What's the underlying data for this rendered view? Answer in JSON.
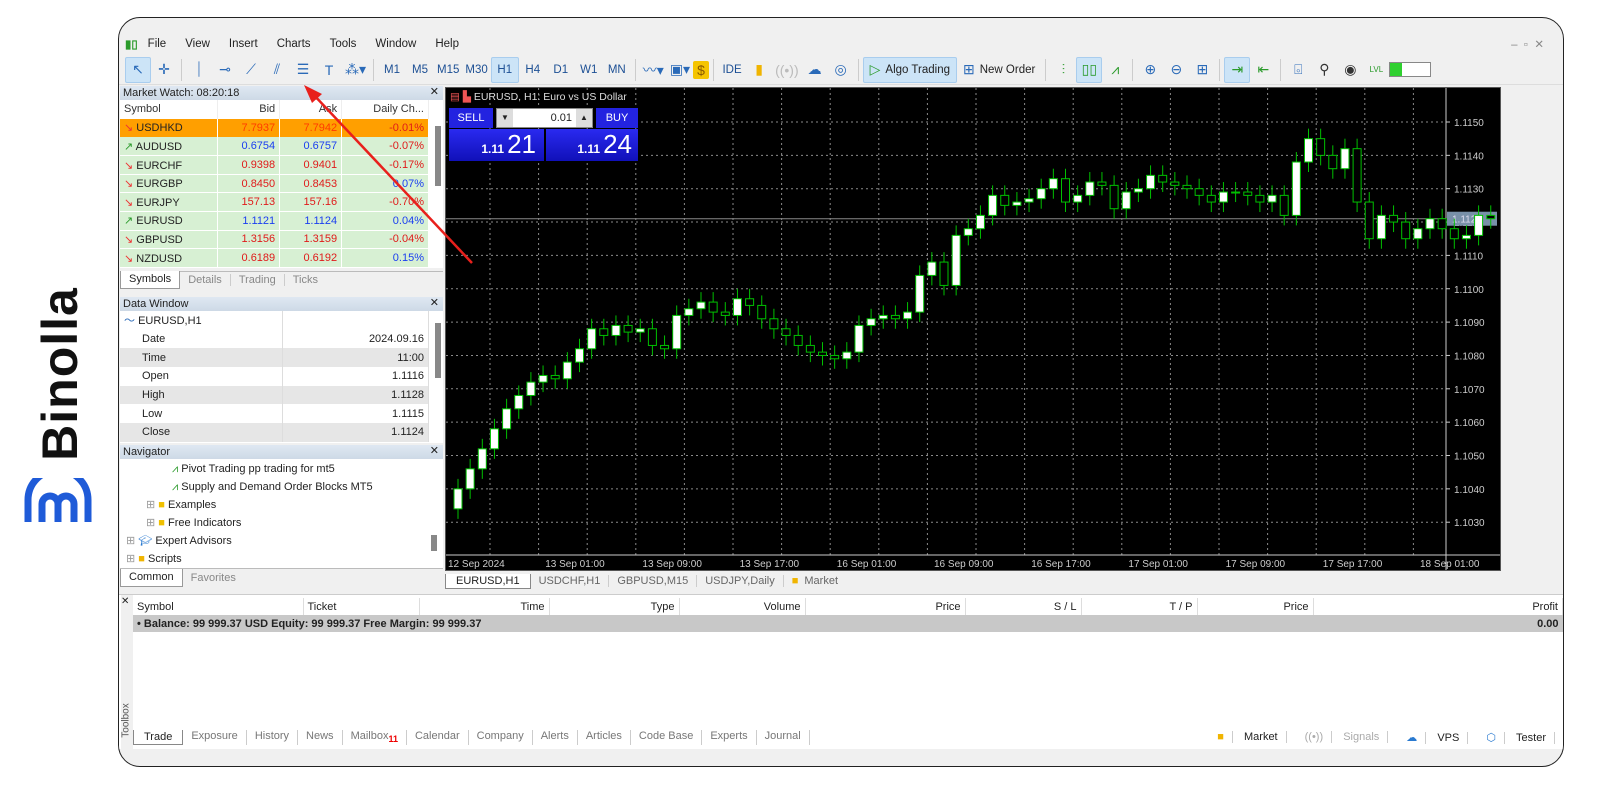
{
  "brand": {
    "name": "Binolla"
  },
  "menu": [
    "File",
    "View",
    "Insert",
    "Charts",
    "Tools",
    "Window",
    "Help"
  ],
  "timeframes": [
    "M1",
    "M5",
    "M15",
    "M30",
    "H1",
    "H4",
    "D1",
    "W1",
    "MN"
  ],
  "active_timeframe": "H1",
  "toolbar": {
    "ide": "IDE",
    "algo_trading": "Algo Trading",
    "new_order": "New Order",
    "lvl": "LVL"
  },
  "market_watch": {
    "title": "Market Watch: 08:20:18",
    "columns": [
      "Symbol",
      "Bid",
      "Ask",
      "Daily Ch..."
    ],
    "rows": [
      {
        "symbol": "USDHKD",
        "bid": "7.7937",
        "ask": "7.7942",
        "change": "-0.01%",
        "dir": "down"
      },
      {
        "symbol": "AUDUSD",
        "bid": "0.6754",
        "ask": "0.6757",
        "change": "-0.07%",
        "dir": "up"
      },
      {
        "symbol": "EURCHF",
        "bid": "0.9398",
        "ask": "0.9401",
        "change": "-0.17%",
        "dir": "down"
      },
      {
        "symbol": "EURGBP",
        "bid": "0.8450",
        "ask": "0.8453",
        "change": "0.07%",
        "dir": "down"
      },
      {
        "symbol": "EURJPY",
        "bid": "157.13",
        "ask": "157.16",
        "change": "-0.70%",
        "dir": "down"
      },
      {
        "symbol": "EURUSD",
        "bid": "1.1121",
        "ask": "1.1124",
        "change": "0.04%",
        "dir": "up"
      },
      {
        "symbol": "GBPUSD",
        "bid": "1.3156",
        "ask": "1.3159",
        "change": "-0.04%",
        "dir": "down"
      },
      {
        "symbol": "NZDUSD",
        "bid": "0.6189",
        "ask": "0.6192",
        "change": "0.15%",
        "dir": "down"
      }
    ],
    "tabs": [
      "Symbols",
      "Details",
      "Trading",
      "Ticks"
    ]
  },
  "data_window": {
    "title": "Data Window",
    "symbol": "EURUSD,H1",
    "rows": [
      [
        "Date",
        "2024.09.16"
      ],
      [
        "Time",
        "11:00"
      ],
      [
        "Open",
        "1.1116"
      ],
      [
        "High",
        "1.1128"
      ],
      [
        "Low",
        "1.1115"
      ],
      [
        "Close",
        "1.1124"
      ]
    ]
  },
  "navigator": {
    "title": "Navigator",
    "items": [
      "Pivot Trading pp trading for mt5",
      "Supply and Demand Order Blocks MT5",
      "Examples",
      "Free Indicators",
      "Expert Advisors",
      "Scripts"
    ],
    "tabs": [
      "Common",
      "Favorites"
    ]
  },
  "chart": {
    "title": "EURUSD, H1:  Euro vs US Dollar",
    "sell": "SELL",
    "buy": "BUY",
    "lot": "0.01",
    "sell_prefix": "1.11",
    "sell_big": "21",
    "buy_prefix": "1.11",
    "buy_big": "24",
    "bid_label": "1.1121",
    "tabs": [
      "EURUSD,H1",
      "USDCHF,H1",
      "GBPUSD,M15",
      "USDJPY,Daily",
      "Market"
    ]
  },
  "chart_data": {
    "type": "candlestick",
    "symbol": "EURUSD",
    "timeframe": "H1",
    "ylim": [
      1.102,
      1.116
    ],
    "yticks": [
      "1.1150",
      "1.1140",
      "1.1130",
      "1.1120",
      "1.1110",
      "1.1100",
      "1.1090",
      "1.1080",
      "1.1070",
      "1.1060",
      "1.1050",
      "1.1040",
      "1.1030"
    ],
    "xticks": [
      "12 Sep 2024",
      "13 Sep 01:00",
      "13 Sep 09:00",
      "13 Sep 17:00",
      "16 Sep 01:00",
      "16 Sep 09:00",
      "16 Sep 17:00",
      "17 Sep 01:00",
      "17 Sep 09:00",
      "17 Sep 17:00",
      "18 Sep 01:00"
    ],
    "wick": 0.0003,
    "first_open": 1.1034,
    "close": [
      1.104,
      1.1046,
      1.1052,
      1.1058,
      1.1064,
      1.1068,
      1.1072,
      1.1074,
      1.1073,
      1.1078,
      1.1082,
      1.1088,
      1.1086,
      1.1089,
      1.1087,
      1.1088,
      1.1083,
      1.1082,
      1.1092,
      1.1094,
      1.1096,
      1.1093,
      1.1092,
      1.1097,
      1.1095,
      1.1091,
      1.1088,
      1.1086,
      1.1083,
      1.1081,
      1.108,
      1.1079,
      1.1081,
      1.1089,
      1.1091,
      1.1092,
      1.1091,
      1.1093,
      1.1104,
      1.1108,
      1.1101,
      1.1116,
      1.1118,
      1.1122,
      1.1128,
      1.1125,
      1.1126,
      1.1127,
      1.113,
      1.1133,
      1.1126,
      1.1128,
      1.1132,
      1.1131,
      1.1124,
      1.1129,
      1.113,
      1.1134,
      1.1132,
      1.1131,
      1.113,
      1.1128,
      1.1126,
      1.1129,
      1.1129,
      1.1128,
      1.1126,
      1.1128,
      1.1122,
      1.1138,
      1.1145,
      1.114,
      1.1136,
      1.1142,
      1.1126,
      1.1115,
      1.1122,
      1.112,
      1.1115,
      1.1118,
      1.1121,
      1.1118,
      1.1115,
      1.1116,
      1.1122,
      1.1121
    ]
  },
  "toolbox": {
    "columns": [
      "Symbol",
      "Ticket",
      "Time",
      "Type",
      "Volume",
      "Price",
      "S / L",
      "T / P",
      "Price",
      "Profit"
    ],
    "balance": "Balance: 99 999.37 USD  Equity: 99 999.37  Free Margin: 99 999.37",
    "profit": "0.00",
    "tabs": [
      "Trade",
      "Exposure",
      "History",
      "News",
      "Mailbox",
      "Calendar",
      "Company",
      "Alerts",
      "Articles",
      "Code Base",
      "Experts",
      "Journal"
    ],
    "mailbox_count": "11",
    "right": [
      "Market",
      "Signals",
      "VPS",
      "Tester"
    ],
    "side_label": "Toolbox"
  },
  "colors": {
    "bull": "#00c000",
    "accent": "#ff9f00",
    "arrow": "#e8201c",
    "blue_panel": "#1a1ad8"
  }
}
